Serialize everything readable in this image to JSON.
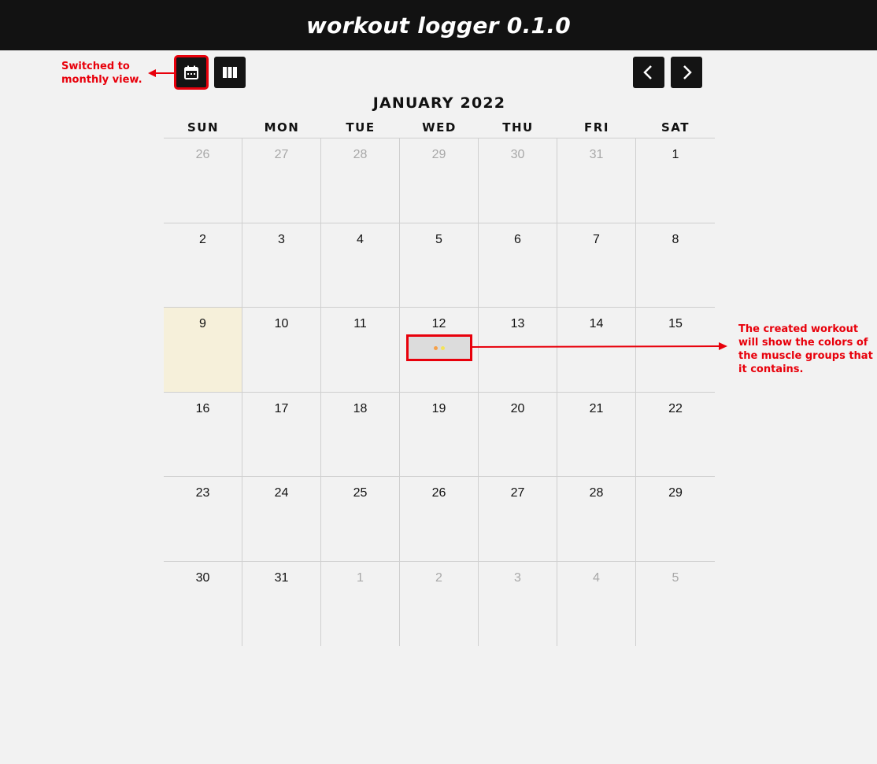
{
  "app": {
    "title": "workout logger 0.1.0"
  },
  "toolbar": {
    "month_view_icon": "calendar-icon",
    "week_view_icon": "columns-icon",
    "prev_icon": "chevron-left-icon",
    "next_icon": "chevron-right-icon"
  },
  "calendar": {
    "month_title": "JANUARY 2022",
    "weekdays": [
      "SUN",
      "MON",
      "TUE",
      "WED",
      "THU",
      "FRI",
      "SAT"
    ],
    "days": [
      {
        "n": "26",
        "current": false
      },
      {
        "n": "27",
        "current": false
      },
      {
        "n": "28",
        "current": false
      },
      {
        "n": "29",
        "current": false
      },
      {
        "n": "30",
        "current": false
      },
      {
        "n": "31",
        "current": false
      },
      {
        "n": "1",
        "current": true
      },
      {
        "n": "2",
        "current": true
      },
      {
        "n": "3",
        "current": true
      },
      {
        "n": "4",
        "current": true
      },
      {
        "n": "5",
        "current": true
      },
      {
        "n": "6",
        "current": true
      },
      {
        "n": "7",
        "current": true
      },
      {
        "n": "8",
        "current": true
      },
      {
        "n": "9",
        "current": true,
        "today": true
      },
      {
        "n": "10",
        "current": true
      },
      {
        "n": "11",
        "current": true
      },
      {
        "n": "12",
        "current": true
      },
      {
        "n": "13",
        "current": true
      },
      {
        "n": "14",
        "current": true
      },
      {
        "n": "15",
        "current": true
      },
      {
        "n": "16",
        "current": true
      },
      {
        "n": "17",
        "current": true
      },
      {
        "n": "18",
        "current": true
      },
      {
        "n": "19",
        "current": true
      },
      {
        "n": "20",
        "current": true
      },
      {
        "n": "21",
        "current": true
      },
      {
        "n": "22",
        "current": true
      },
      {
        "n": "23",
        "current": true
      },
      {
        "n": "24",
        "current": true
      },
      {
        "n": "25",
        "current": true
      },
      {
        "n": "26",
        "current": true
      },
      {
        "n": "27",
        "current": true
      },
      {
        "n": "28",
        "current": true
      },
      {
        "n": "29",
        "current": true
      },
      {
        "n": "30",
        "current": true
      },
      {
        "n": "31",
        "current": true
      },
      {
        "n": "1",
        "current": false
      },
      {
        "n": "2",
        "current": false
      },
      {
        "n": "3",
        "current": false
      },
      {
        "n": "4",
        "current": false
      },
      {
        "n": "5",
        "current": false
      }
    ],
    "workout": {
      "day": "12",
      "muscle_colors": [
        "#f5a04a",
        "#f3e35a"
      ]
    },
    "today_color": "#f6f0da"
  },
  "annotations": {
    "note_1": "Switched to monthly view.",
    "note_2": "The created workout will show the colors of the muscle groups that it contains.",
    "color": "#e8000b"
  }
}
